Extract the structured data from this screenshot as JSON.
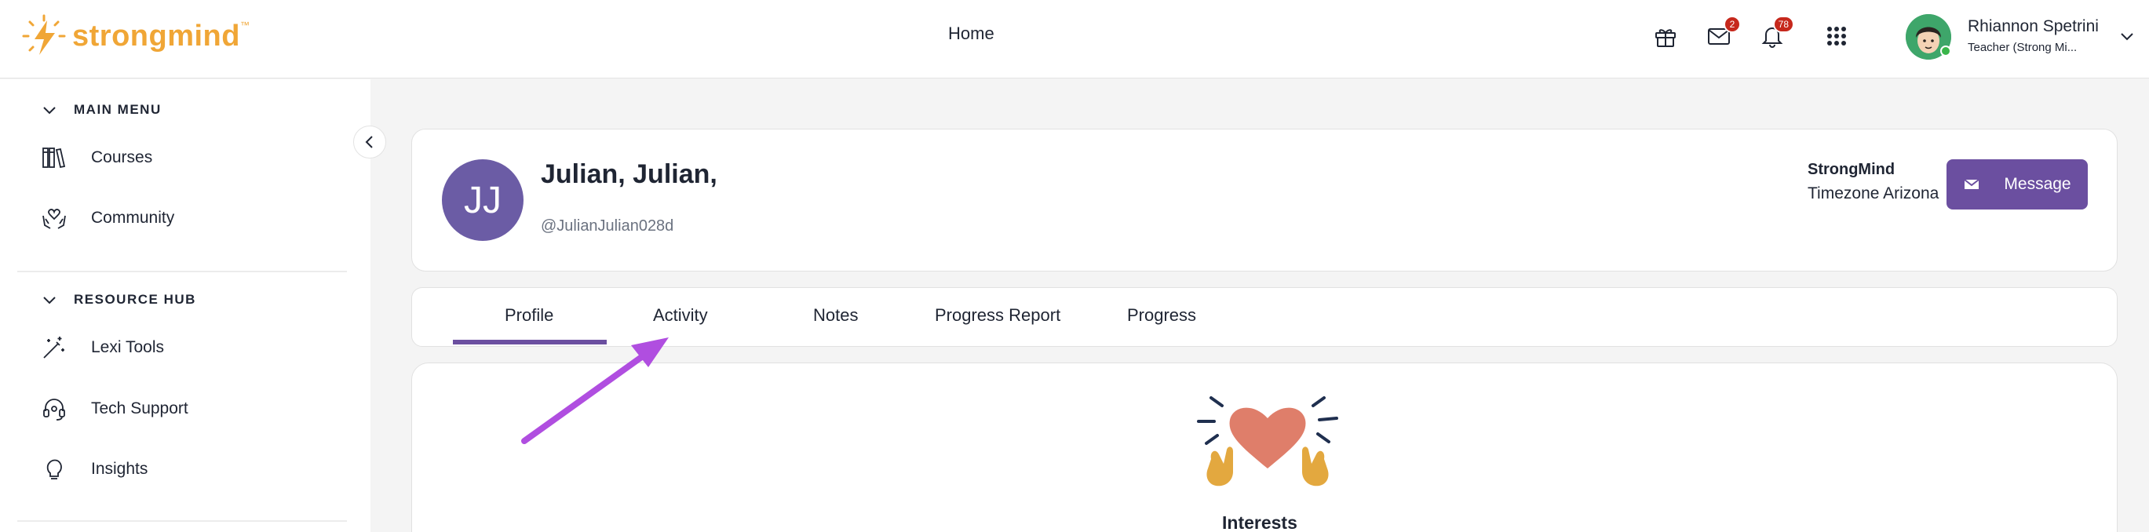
{
  "header": {
    "logo_text": "strongmind",
    "logo_tm": "™",
    "home_label": "Home",
    "icons": [
      "gift-icon",
      "mail-icon",
      "bell-icon",
      "apps-grid-icon"
    ],
    "mail_badge": "2",
    "notifications_badge": "78",
    "user_name": "Rhiannon Spetrini",
    "user_role": "Teacher (Strong Mi..."
  },
  "sidebar": {
    "main_menu_label": "MAIN MENU",
    "main_items": [
      {
        "label": "Courses",
        "icon": "books-icon"
      },
      {
        "label": "Community",
        "icon": "heart-hands-icon"
      }
    ],
    "resource_hub_label": "RESOURCE HUB",
    "resource_items": [
      {
        "label": "Lexi Tools",
        "icon": "magic-wand-icon"
      },
      {
        "label": "Tech Support",
        "icon": "headset-icon"
      },
      {
        "label": "Insights",
        "icon": "lightbulb-icon"
      }
    ]
  },
  "profile": {
    "initials": "JJ",
    "name": "Julian, Julian,",
    "handle": "@JulianJulian028d",
    "org": "StrongMind",
    "timezone": "Timezone Arizona",
    "message_button": "Message"
  },
  "tabs": [
    {
      "label": "Profile",
      "active": true
    },
    {
      "label": "Activity",
      "active": false
    },
    {
      "label": "Notes",
      "active": false
    },
    {
      "label": "Progress Report",
      "active": false
    },
    {
      "label": "Progress",
      "active": false
    }
  ],
  "interests": {
    "title": "Interests"
  },
  "colors": {
    "brand_orange": "#f0a636",
    "accent_purple": "#6b4fa0",
    "avatar_purple": "#6b5ca5",
    "badge_red": "#c6281c",
    "annotation_arrow": "#b04ee0"
  }
}
